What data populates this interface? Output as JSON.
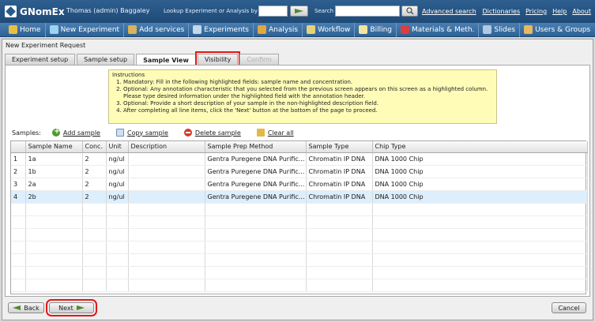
{
  "header": {
    "app_name": "GNomEx",
    "user": "Thomas (admin) Baggaley",
    "lookup_label": "Lookup Experiment or Analysis by #",
    "lookup_value": "",
    "search_label": "Search",
    "search_value": "",
    "advanced_search": "Advanced search",
    "links": [
      "Dictionaries",
      "Pricing",
      "Help",
      "About"
    ]
  },
  "nav": {
    "items": [
      {
        "label": "Home",
        "icon": "home-icon",
        "color": "#e8c040"
      },
      {
        "label": "New Experiment",
        "icon": "new-experiment-icon",
        "color": "#9cd3f0"
      },
      {
        "label": "Add services",
        "icon": "add-services-icon",
        "color": "#d9b25a"
      },
      {
        "label": "Experiments",
        "icon": "experiments-icon",
        "color": "#c0d8ea"
      },
      {
        "label": "Analysis",
        "icon": "analysis-icon",
        "color": "#e0a840"
      },
      {
        "label": "Workflow",
        "icon": "workflow-icon",
        "color": "#e6d27a"
      },
      {
        "label": "Billing",
        "icon": "billing-icon",
        "color": "#f0e6a0"
      },
      {
        "label": "Materials & Meth.",
        "icon": "materials-icon",
        "color": "#d84040"
      },
      {
        "label": "Slides",
        "icon": "slides-icon",
        "color": "#b0c8e0"
      },
      {
        "label": "Users & Groups",
        "icon": "users-icon",
        "color": "#e8b860"
      }
    ]
  },
  "panel": {
    "title": "New Experiment Request",
    "tabs": [
      {
        "label": "Experiment setup",
        "state": "normal"
      },
      {
        "label": "Sample setup",
        "state": "normal"
      },
      {
        "label": "Sample View",
        "state": "active"
      },
      {
        "label": "Visibility",
        "state": "outlined"
      },
      {
        "label": "Confirm",
        "state": "disabled"
      }
    ]
  },
  "instructions": {
    "heading": "Instructions",
    "items": [
      "Mandatory: Fill in the following highlighted fields:  sample name and concentration.",
      "Optional: Any annotation characteristic that you selected from the previous screen appears on this screen as a highlighted column. Please type desired information under the highlighted field with the annotation header.",
      "Optional: Provide a short description of your sample in the non-highlighted description field.",
      "After completing all line items, click the 'Next' button at the bottom of the page to proceed."
    ]
  },
  "samples": {
    "label": "Samples:",
    "add": "Add sample",
    "copy": "Copy sample",
    "delete": "Delete sample",
    "clear": "Clear all"
  },
  "grid": {
    "columns": [
      "",
      "Sample Name",
      "Conc.",
      "Unit",
      "Description",
      "Sample Prep Method",
      "Sample Type",
      "Chip Type"
    ],
    "rows": [
      [
        "1",
        "1a",
        "2",
        "ng/ul",
        "",
        "Gentra Puregene DNA Purific...",
        "Chromatin IP DNA",
        "DNA 1000 Chip"
      ],
      [
        "2",
        "1b",
        "2",
        "ng/ul",
        "",
        "Gentra Puregene DNA Purific...",
        "Chromatin IP DNA",
        "DNA 1000 Chip"
      ],
      [
        "3",
        "2a",
        "2",
        "ng/ul",
        "",
        "Gentra Puregene DNA Purific...",
        "Chromatin IP DNA",
        "DNA 1000 Chip"
      ],
      [
        "4",
        "2b",
        "2",
        "ng/ul",
        "",
        "Gentra Puregene DNA Purific...",
        "Chromatin IP DNA",
        "DNA 1000 Chip"
      ]
    ],
    "selected_row": 3
  },
  "footer": {
    "back": "Back",
    "next": "Next",
    "cancel": "Cancel"
  },
  "colors": {
    "header_bg": "#2e5f8f",
    "highlight_outline": "#e01818",
    "instructions_bg": "#fffcb8",
    "selected_row": "#ddeefc"
  }
}
